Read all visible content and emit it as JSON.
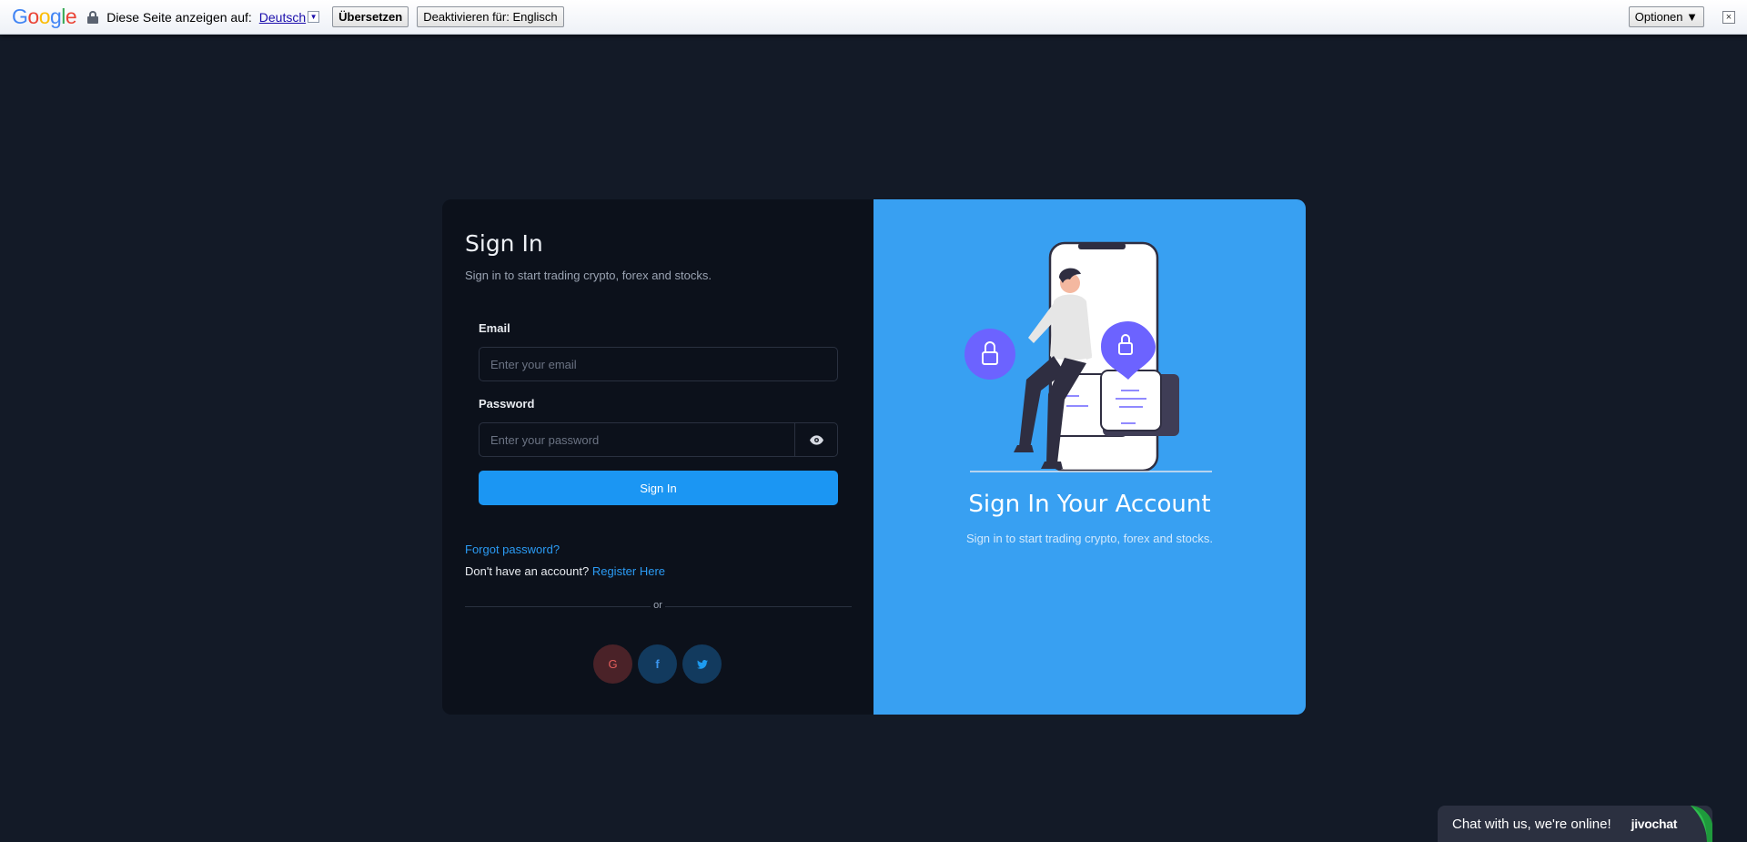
{
  "translate_bar": {
    "logo": [
      "G",
      "o",
      "o",
      "g",
      "l",
      "e"
    ],
    "logo_colors": [
      "#4285f4",
      "#ea4335",
      "#fbbc05",
      "#4285f4",
      "#34a853",
      "#ea4335"
    ],
    "prompt": "Diese Seite anzeigen auf:",
    "language": "Deutsch",
    "translate_button": "Übersetzen",
    "disable_button": "Deaktivieren für: Englisch",
    "options_button": "Optionen ▼",
    "close_glyph": "×"
  },
  "signin": {
    "title": "Sign In",
    "subtitle": "Sign in to start trading crypto, forex and stocks.",
    "email_label": "Email",
    "email_placeholder": "Enter your email",
    "email_value": "",
    "password_label": "Password",
    "password_placeholder": "Enter your password",
    "password_value": "",
    "submit_label": "Sign In",
    "forgot_label": "Forgot password?",
    "no_account_text": "Don't have an account?",
    "register_label": "Register Here",
    "divider_text": "or",
    "social": {
      "google": "G",
      "facebook": "f"
    }
  },
  "promo": {
    "title": "Sign In Your Account",
    "subtitle": "Sign in to start trading crypto, forex and stocks."
  },
  "chat": {
    "text": "Chat with us, we're online!",
    "brand": "jivochat"
  },
  "colors": {
    "page_bg": "#131a27",
    "card_left_bg": "#0c111b",
    "card_right_bg": "#38a0f2",
    "primary": "#1b96f3",
    "link": "#2b9bf4",
    "illustration_accent": "#6c63ff"
  }
}
